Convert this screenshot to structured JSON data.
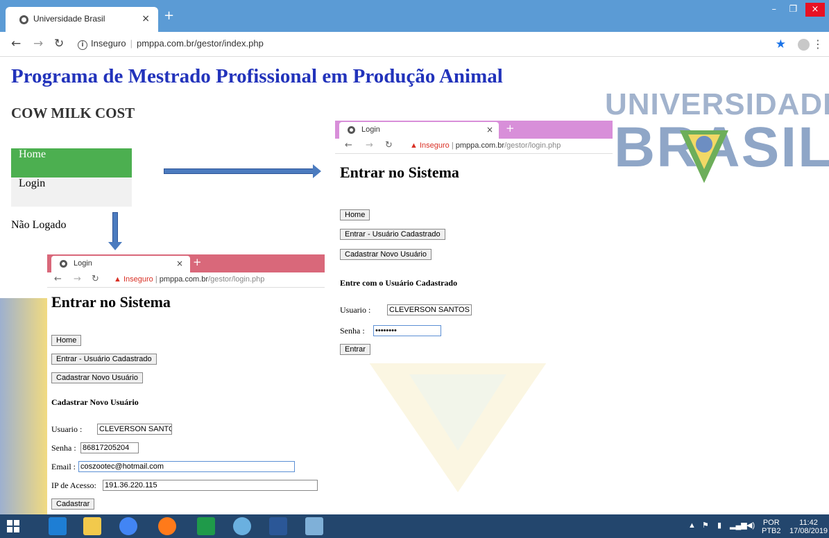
{
  "browser": {
    "tab_title": "Universidade Brasil",
    "tab_close": "×",
    "new_tab": "+",
    "security": "Inseguro",
    "url": "pmppa.com.br/gestor/index.php",
    "minimize": "–",
    "maximize": "❐",
    "close": "×"
  },
  "page": {
    "title": "Programa de Mestrado Profissional em Produção Animal",
    "subtitle": "COW MILK COST",
    "menu": [
      "Home",
      "Login"
    ],
    "status": "Não Logado",
    "logo_line1": "UNIVERSIDADE",
    "logo_line2": "BRASIL"
  },
  "shot1": {
    "tab_title": "Login",
    "tab_close": "×",
    "new_tab": "+",
    "security": "Inseguro",
    "url_domain": "pmppa.com.br",
    "url_path": "/gestor/login.php",
    "heading": "Entrar no Sistema",
    "buttons": [
      "Home",
      "Entrar - Usuário Cadastrado",
      "Cadastrar Novo Usuário"
    ],
    "section": "Entre com o Usuário Cadastrado",
    "user_label": "Usuario :",
    "user_value": "CLEVERSON SANTOS",
    "pass_label": "Senha :",
    "pass_value": "••••••••",
    "submit": "Entrar"
  },
  "shot2": {
    "tab_title": "Login",
    "tab_close": "×",
    "new_tab": "+",
    "security": "Inseguro",
    "url_domain": "pmppa.com.br",
    "url_path": "/gestor/login.php",
    "heading": "Entrar no Sistema",
    "buttons": [
      "Home",
      "Entrar - Usuário Cadastrado",
      "Cadastrar Novo Usuário"
    ],
    "section": "Cadastrar Novo Usuário",
    "user_label": "Usuario :",
    "user_value": "CLEVERSON SANTOS",
    "pass_label": "Senha :",
    "pass_value": "86817205204",
    "email_label": "Email :",
    "email_value": "coszootec@hotmail.com",
    "ip_label": "IP de Acesso:",
    "ip_value": "191.36.220.115",
    "submit": "Cadastrar"
  },
  "taskbar": {
    "lang_top": "POR",
    "lang_bottom": "PTB2",
    "time": "11:42",
    "date": "17/08/2019"
  }
}
